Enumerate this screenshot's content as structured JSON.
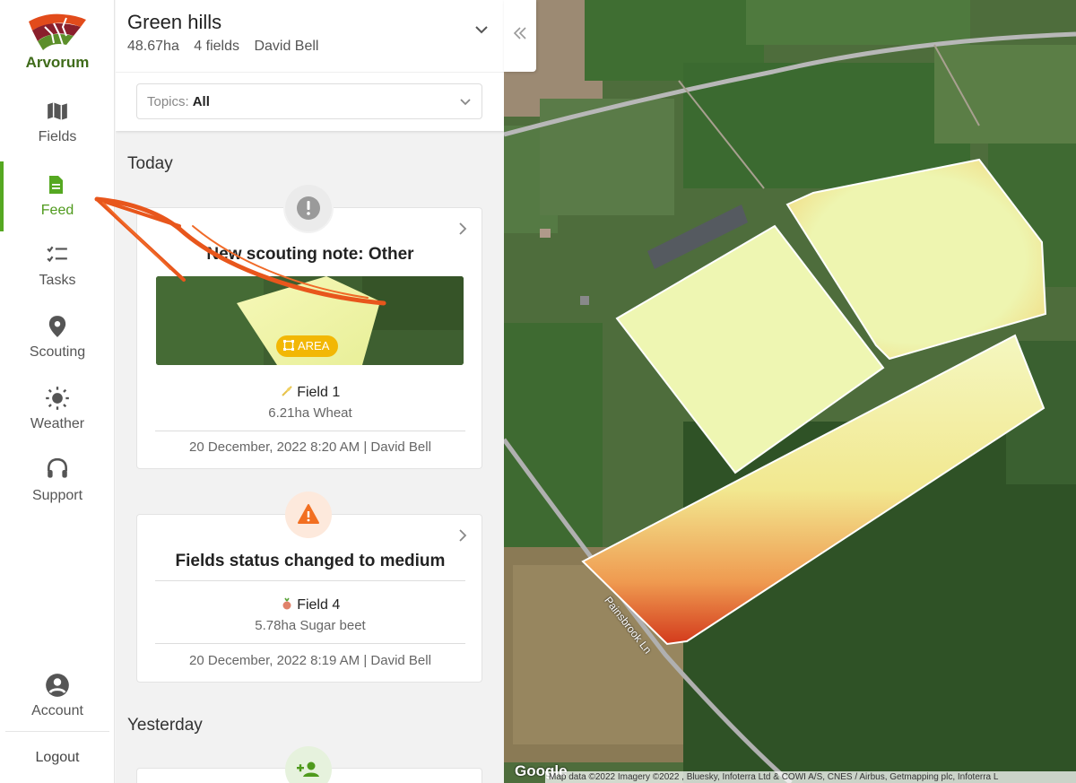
{
  "app": {
    "brand": "Arvorum"
  },
  "nav": {
    "items": [
      {
        "label": "Fields",
        "icon": "map-icon"
      },
      {
        "label": "Feed",
        "icon": "document-icon",
        "active": true
      },
      {
        "label": "Tasks",
        "icon": "checklist-icon"
      },
      {
        "label": "Scouting",
        "icon": "pin-icon"
      },
      {
        "label": "Weather",
        "icon": "sun-icon"
      },
      {
        "label": "Support",
        "icon": "headset-icon"
      }
    ],
    "account": {
      "label": "Account",
      "icon": "account-icon"
    },
    "logout_label": "Logout"
  },
  "header": {
    "farm_name": "Green hills",
    "area": "48.67ha",
    "fields": "4 fields",
    "owner": "David Bell"
  },
  "filter": {
    "label": "Topics:",
    "value": "All"
  },
  "feed": {
    "today_label": "Today",
    "yesterday_label": "Yesterday",
    "cards": [
      {
        "title": "New scouting note: Other",
        "icon": "exclamation-icon",
        "tag": "AREA",
        "field": "Field 1",
        "crop": "6.21ha Wheat",
        "footer": "20 December, 2022 8:20 AM | David Bell"
      },
      {
        "title": "Fields status changed to medium",
        "icon": "warning-icon",
        "field": "Field 4",
        "crop": "5.78ha Sugar beet",
        "footer": "20 December, 2022 8:19 AM | David Bell"
      }
    ]
  },
  "map": {
    "road_label": "Painsbrook Ln",
    "google": "Google",
    "attribution": "Map data ©2022 Imagery ©2022 , Bluesky, Infoterra Ltd & COWI A/S, CNES / Airbus, Getmapping plc, Infoterra L"
  },
  "colors": {
    "accent": "#55a821",
    "warning": "#f26f21",
    "tag": "#f2b705"
  }
}
